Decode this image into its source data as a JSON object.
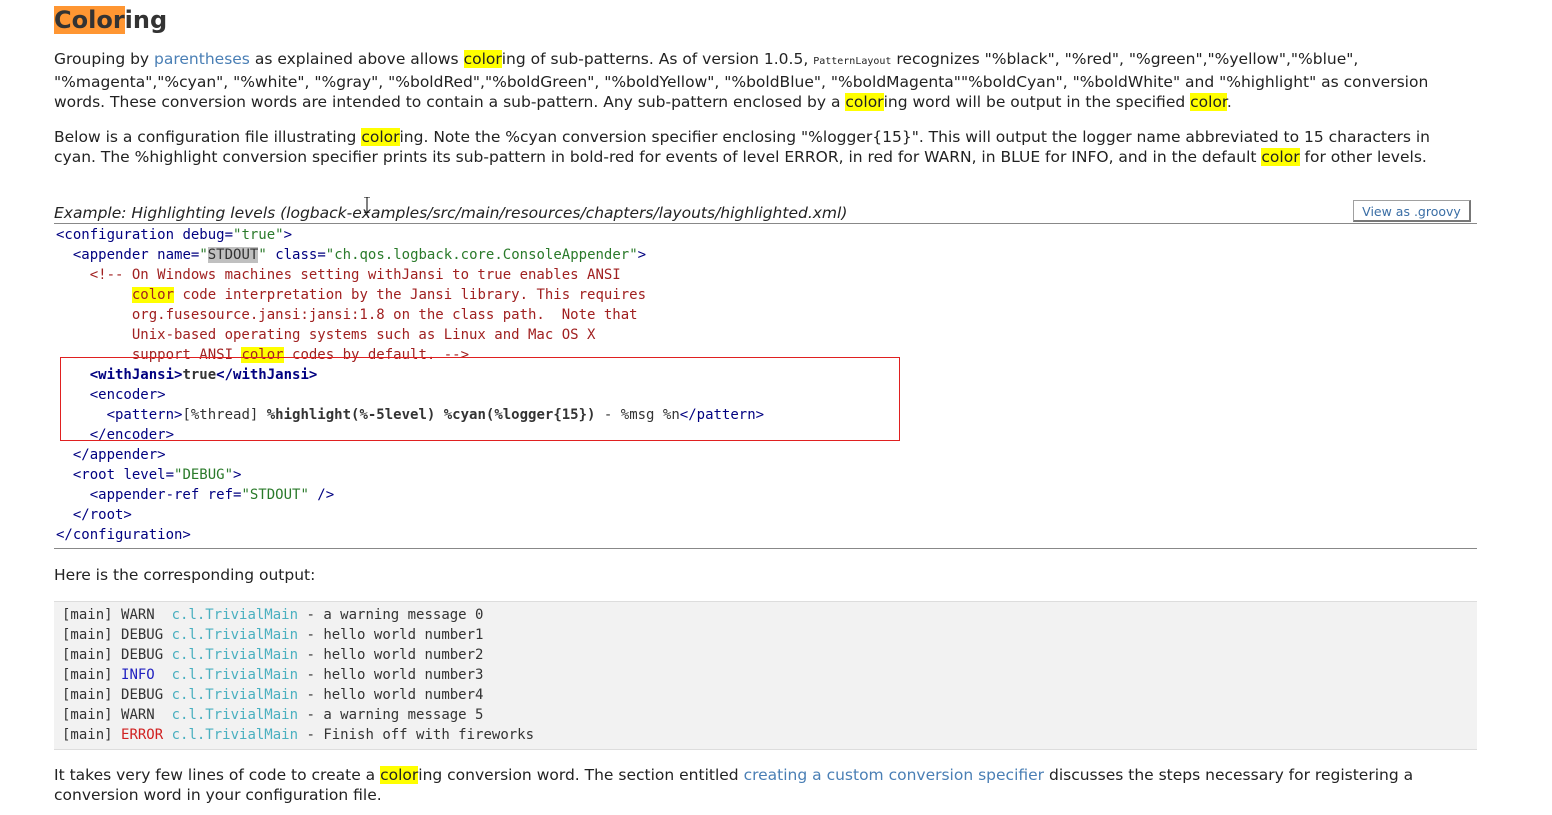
{
  "heading": {
    "highlighted": "Color",
    "rest": "ing"
  },
  "para1": {
    "t1": "Grouping by ",
    "link": "parentheses",
    "t2": " as explained above allows ",
    "h1": "color",
    "t3": "ing of sub-patterns. As of version 1.0.5, ",
    "code": "PatternLayout",
    "t4": " recognizes \"%black\", \"%red\", \"%green\",\"%yellow\",\"%blue\", \"%magenta\",\"%cyan\", \"%white\", \"%gray\", \"%boldRed\",\"%boldGreen\", \"%boldYellow\", \"%boldBlue\", \"%boldMagenta\"\"%boldCyan\", \"%boldWhite\" and \"%highlight\" as conversion words. These conversion words are intended to contain a sub-pattern. Any sub-pattern enclosed by a ",
    "h2": "color",
    "t5": "ing word will be output in the specified ",
    "h3": "color",
    "t6": "."
  },
  "para2": {
    "t1": "Below is a configuration file illustrating ",
    "h1": "color",
    "t2": "ing. Note the %cyan conversion specifier enclosing \"%logger{15}\". This will output the logger name abbreviated to 15 characters in cyan. The %highlight conversion specifier prints its sub-pattern in bold-red for events of level ERROR, in red for WARN, in BLUE for INFO, and in the default ",
    "h2": "color",
    "t3": " for other levels."
  },
  "example": {
    "title": "Example: Highlighting levels (logback-examples/src/main/resources/chapters/layouts/highlighted.xml)",
    "groovy_button": "View as .groovy"
  },
  "code": {
    "l1_open": "<configuration ",
    "l1_attr": "debug=",
    "l1_val": "\"true\"",
    "l1_close": ">",
    "l2_open": "  <appender ",
    "l2_attr1": "name=",
    "l2_q1": "\"",
    "l2_name": "STDOUT",
    "l2_q2": "\"",
    "l2_attr2": " class=",
    "l2_val2": "\"ch.qos.logback.core.ConsoleAppender\"",
    "l2_close": ">",
    "c1": "    <!-- On Windows machines setting withJansi to true enables ANSI",
    "c2_pre": "         ",
    "c2_hl": "color",
    "c2_post": " code interpretation by the Jansi library. This requires",
    "c3": "         org.fusesource.jansi:jansi:1.8 on the class path.  Note that",
    "c4": "         Unix-based operating systems such as Linux and Mac OS X",
    "c5_pre": "         support ANSI ",
    "c5_hl": "color",
    "c5_post": " codes by default. -->",
    "l6_indent": "    ",
    "l6_open": "<withJansi>",
    "l6_val": "true",
    "l6_close": "</withJansi>",
    "l7": "    <encoder>",
    "l8_indent": "      ",
    "l8_open": "<pattern>",
    "l8_a": "[%thread] ",
    "l8_b": "%highlight(",
    "l8_c": "%-5level",
    "l8_d": ") ",
    "l8_e": "%cyan(",
    "l8_f": "%logger{15}",
    "l8_g": ")",
    "l8_h": " - %msg %n",
    "l8_close": "</pattern>",
    "l9": "    </encoder>",
    "l10": "  </appender>",
    "l11_open": "  <root ",
    "l11_attr": "level=",
    "l11_val": "\"DEBUG\"",
    "l11_close": ">",
    "l12_open": "    <appender-ref ",
    "l12_attr": "ref=",
    "l12_val": "\"STDOUT\"",
    "l12_close": " />",
    "l13": "  </root>",
    "l14": "</configuration>"
  },
  "output_intro": "Here is the corresponding output:",
  "output_lines": [
    {
      "thread": "[main] ",
      "level": "WARN ",
      "levelClass": "lv-warn",
      "logger": "c.l.TrivialMain",
      "msg": " - a warning message 0"
    },
    {
      "thread": "[main] ",
      "level": "DEBUG",
      "levelClass": "lv-debug",
      "logger": "c.l.TrivialMain",
      "msg": " - hello world number1"
    },
    {
      "thread": "[main] ",
      "level": "DEBUG",
      "levelClass": "lv-debug",
      "logger": "c.l.TrivialMain",
      "msg": " - hello world number2"
    },
    {
      "thread": "[main] ",
      "level": "INFO ",
      "levelClass": "lv-info",
      "logger": "c.l.TrivialMain",
      "msg": " - hello world number3"
    },
    {
      "thread": "[main] ",
      "level": "DEBUG",
      "levelClass": "lv-debug",
      "logger": "c.l.TrivialMain",
      "msg": " - hello world number4"
    },
    {
      "thread": "[main] ",
      "level": "WARN ",
      "levelClass": "lv-warn",
      "logger": "c.l.TrivialMain",
      "msg": " - a warning message 5"
    },
    {
      "thread": "[main] ",
      "level": "ERROR",
      "levelClass": "lv-error",
      "logger": "c.l.TrivialMain",
      "msg": " - Finish off with fireworks"
    }
  ],
  "para3": {
    "t1": "It takes very few lines of code to create a ",
    "h1": "color",
    "t2": "ing conversion word. The section entitled ",
    "link": "creating a custom conversion specifier",
    "t3": " discusses the steps necessary for registering a conversion word in your configuration file."
  },
  "colors": {
    "highlight": "#ffff00",
    "heading_highlight": "#ff9632",
    "link": "#4a7fb5",
    "box": "#e02020"
  }
}
